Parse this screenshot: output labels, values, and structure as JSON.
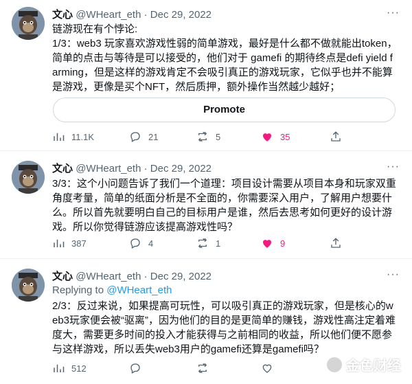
{
  "tweets": [
    {
      "name": "文心",
      "handle": "@WHeart_eth",
      "dot": "·",
      "date": "Dec 29, 2022",
      "more": "···",
      "body": "链游现在有个悖论:\n1/3：web3 玩家喜欢游戏性弱的简单游戏，最好是什么都不做就能出token，简单的点击与等待是可以接受的，他们对于 gamefi 的期待终点是defi yield farming，但是这样的游戏肯定不会吸引真正的游戏玩家，它似乎也并不能算是游戏，更像是买个NFT，然后质押，额外操作当然越少越好；",
      "promote": "Promote",
      "stats": {
        "views": "11.1K",
        "replies": "21",
        "retweets": "5",
        "likes": "35"
      }
    },
    {
      "name": "文心",
      "handle": "@WHeart_eth",
      "dot": "·",
      "date": "Dec 29, 2022",
      "more": "···",
      "body": "3/3：这个小问题告诉了我们一个道理：项目设计需要从项目本身和玩家双重角度考量，简单的纸面分析是不全面的，你需要深入用户，了解用户想要什么。所以首先就要明白自己的目标用户是谁，然后去思考如何更好的设计游戏。所以你觉得链游应该提高游戏性吗？",
      "stats": {
        "views": "387",
        "replies": "4",
        "retweets": "1",
        "likes": "9"
      }
    },
    {
      "name": "文心",
      "handle": "@WHeart_eth",
      "dot": "·",
      "date": "Dec 29, 2022",
      "more": "···",
      "replying_prefix": "Replying to",
      "replying_to": "@WHeart_eth",
      "body": "2/3：反过来说，如果提高可玩性，可以吸引真正的游戏玩家，但是核心的web3玩家便会被“驱离”，因为他们的目的是更简单的赚钱，游戏性高注定着难度大，需要更多时间的投入才能获得与之前相同的收益，所以他们便不愿参与这样游戏，所以丢失web3用户的gamefi还算是gamefi吗？",
      "stats": {
        "views": "512",
        "replies": "",
        "retweets": "",
        "likes": ""
      }
    }
  ],
  "watermark": {
    "text": "金色财经"
  },
  "colors": {
    "accent": "#1d9bf0",
    "like": "#f91880",
    "muted": "#536471",
    "border": "#eff3f4"
  },
  "icons": [
    "views-icon",
    "reply-icon",
    "retweet-icon",
    "like-icon",
    "share-icon",
    "more-icon",
    "avatar-ape"
  ]
}
